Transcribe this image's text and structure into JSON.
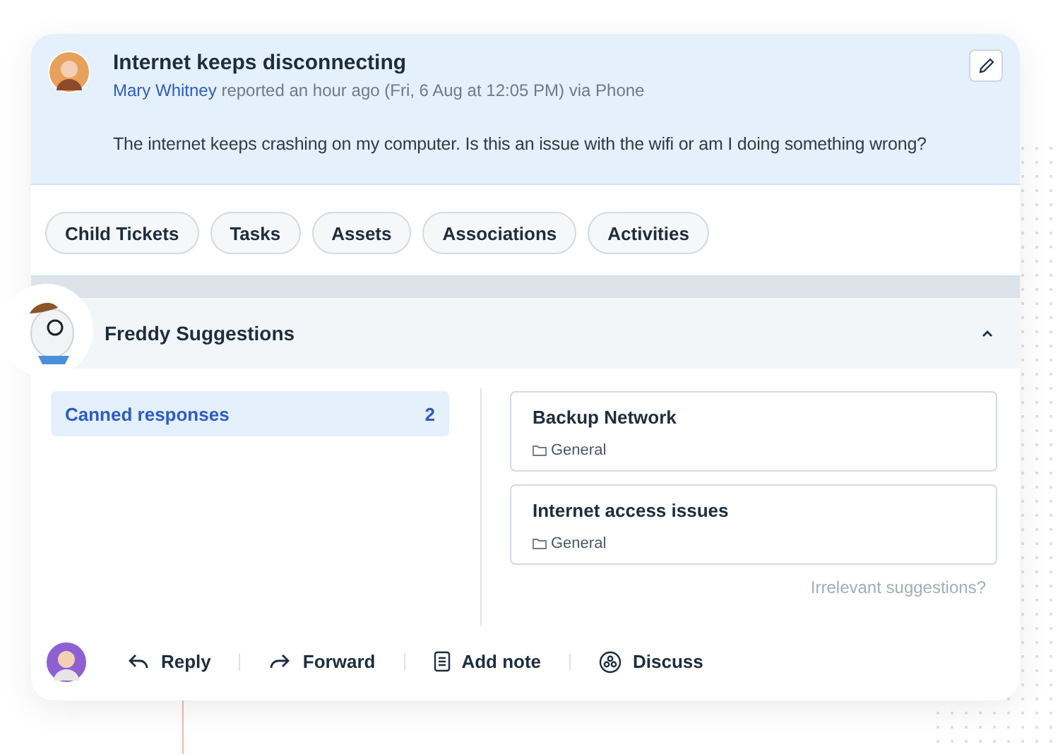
{
  "ticket": {
    "title": "Internet keeps disconnecting",
    "requester": "Mary Whitney",
    "meta": "reported an hour ago (Fri, 6 Aug at 12:05 PM) via Phone",
    "message": "The internet keeps crashing on my computer. Is this an issue with the wifi or am I doing something wrong?"
  },
  "tabs": [
    {
      "label": "Child Tickets"
    },
    {
      "label": "Tasks"
    },
    {
      "label": "Assets"
    },
    {
      "label": "Associations"
    },
    {
      "label": "Activities"
    }
  ],
  "suggestions": {
    "title": "Freddy Suggestions",
    "expanded": true,
    "categories": [
      {
        "label": "Canned responses",
        "count": "2",
        "selected": true
      }
    ],
    "responses": [
      {
        "title": "Backup Network",
        "folder": "General"
      },
      {
        "title": "Internet access issues",
        "folder": "General"
      }
    ],
    "feedback_link": "Irrelevant suggestions?"
  },
  "actions": [
    {
      "kind": "reply",
      "label": "Reply"
    },
    {
      "kind": "forward",
      "label": "Forward"
    },
    {
      "kind": "note",
      "label": "Add note"
    },
    {
      "kind": "discuss",
      "label": "Discuss"
    }
  ]
}
